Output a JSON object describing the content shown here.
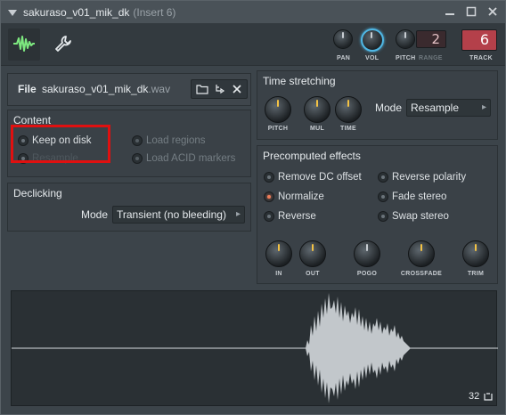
{
  "window": {
    "title": "sakuraso_v01_mik_dk",
    "subtitle": "(Insert 6)"
  },
  "header": {
    "knobs": [
      {
        "label": "PAN"
      },
      {
        "label": "VOL"
      },
      {
        "label": "PITCH"
      }
    ],
    "range_label": "RANGE",
    "range_value": "2",
    "track_label": "TRACK",
    "track_value": "6"
  },
  "file": {
    "label": "File",
    "name": "sakuraso_v01_mik_dk",
    "ext": ".wav"
  },
  "content": {
    "title": "Content",
    "options": [
      {
        "label": "Keep on disk",
        "checked": false
      },
      {
        "label": "Resample",
        "checked": false
      },
      {
        "label": "Load regions",
        "checked": true
      },
      {
        "label": "Load ACID markers",
        "checked": false
      }
    ]
  },
  "declicking": {
    "title": "Declicking",
    "mode_label": "Mode",
    "mode_value": "Transient (no bleeding)"
  },
  "time_stretching": {
    "title": "Time stretching",
    "knobs": [
      "PITCH",
      "MUL",
      "TIME"
    ],
    "mode_label": "Mode",
    "mode_value": "Resample"
  },
  "precomputed": {
    "title": "Precomputed effects",
    "left": [
      {
        "label": "Remove DC offset",
        "checked": false
      },
      {
        "label": "Normalize",
        "checked": true
      },
      {
        "label": "Reverse",
        "checked": false
      }
    ],
    "right": [
      {
        "label": "Reverse polarity",
        "checked": false
      },
      {
        "label": "Fade stereo",
        "checked": false
      },
      {
        "label": "Swap stereo",
        "checked": false
      }
    ],
    "knobs": [
      "IN",
      "OUT",
      "POGO",
      "CROSSFADE",
      "TRIM"
    ]
  },
  "waveform": {
    "zoom_value": "32"
  }
}
